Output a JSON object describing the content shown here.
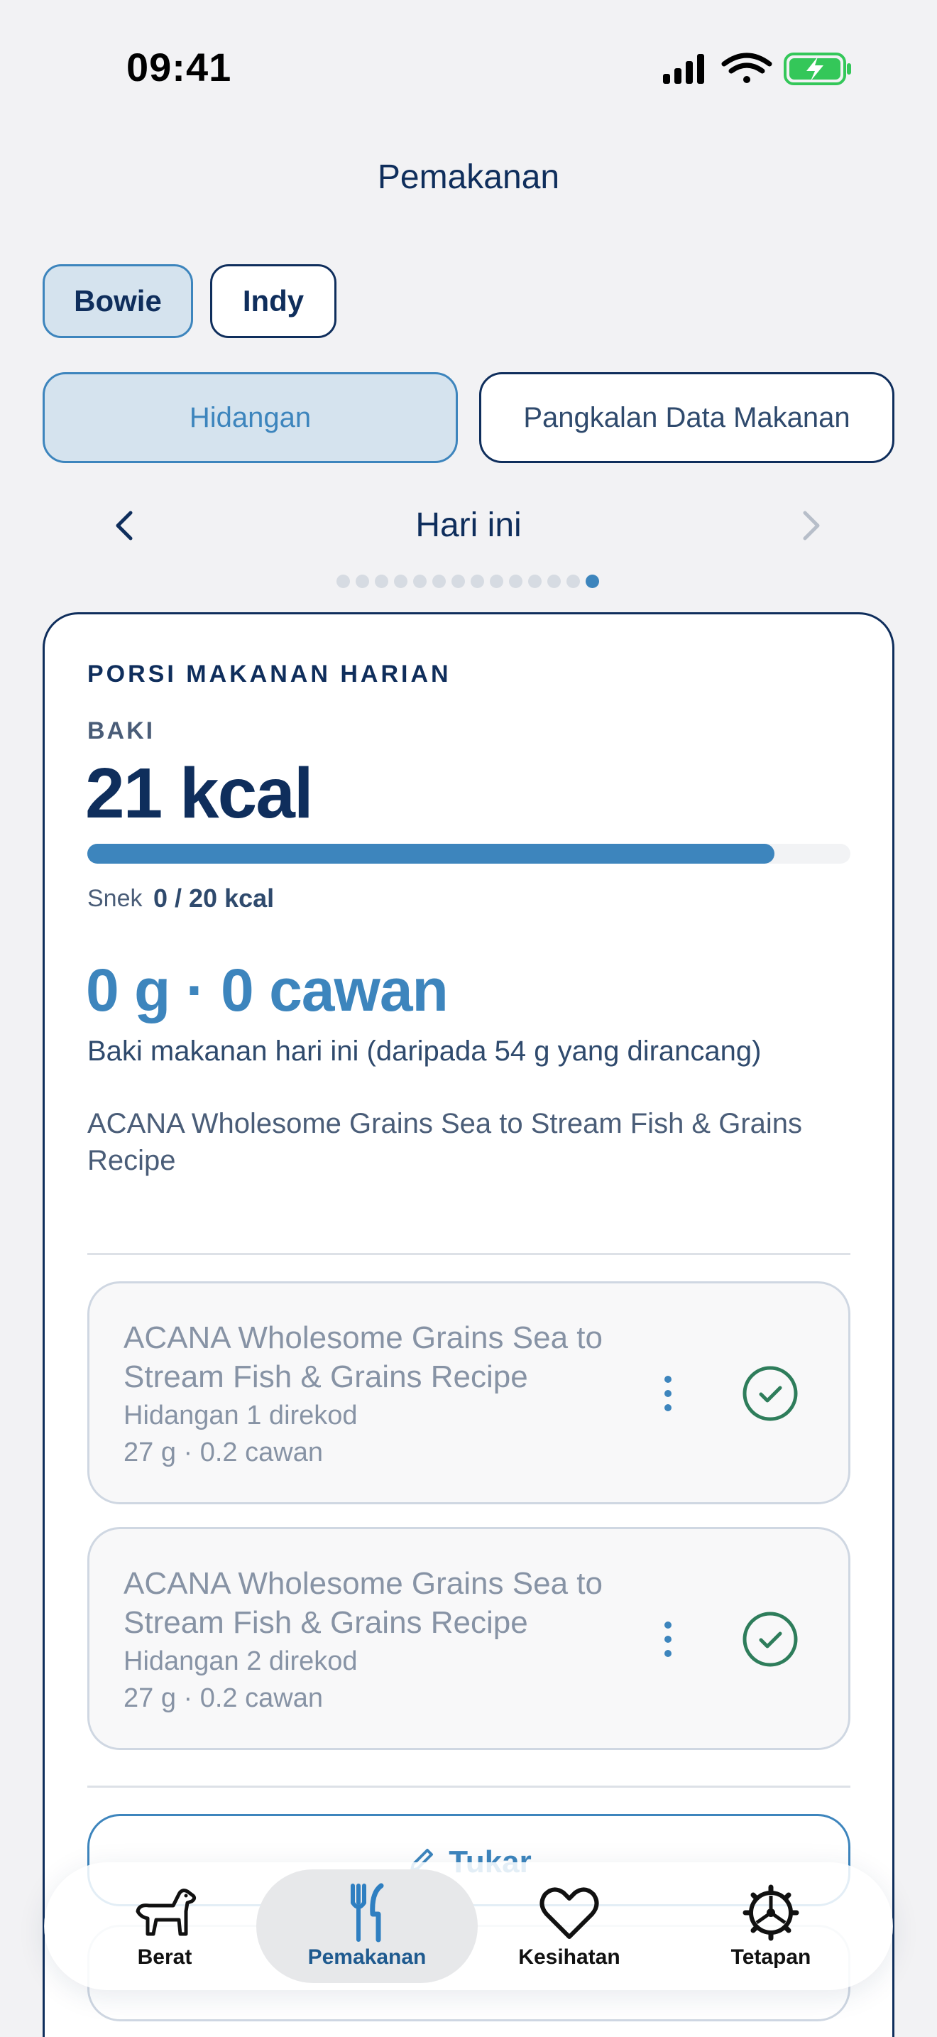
{
  "status": {
    "time": "09:41"
  },
  "page": {
    "title": "Pemakanan"
  },
  "pets": [
    {
      "label": "Bowie",
      "active": true
    },
    {
      "label": "Indy",
      "active": false
    }
  ],
  "modes": [
    {
      "label": "Hidangan",
      "active": true
    },
    {
      "label": "Pangkalan Data Makanan",
      "active": false
    }
  ],
  "date_nav": {
    "label": "Hari ini",
    "page_count": 14,
    "active_page": 14
  },
  "daily": {
    "section_title": "PORSI MAKANAN HARIAN",
    "remaining_label": "BAKI",
    "remaining_kcal": "21 kcal",
    "progress_fraction": 0.9,
    "snack_label": "Snek",
    "snack_value": "0 / 20 kcal",
    "grams_cups": "0 g · 0 cawan",
    "remaining_desc": "Baki makanan hari ini (daripada 54 g yang dirancang)",
    "food_name": "ACANA Wholesome Grains Sea to Stream Fish & Grains Recipe"
  },
  "meals": [
    {
      "title": "ACANA Wholesome Grains Sea to Stream Fish & Grains Recipe",
      "status": "Hidangan 1 direkod",
      "amount": "27 g · 0.2 cawan"
    },
    {
      "title": "ACANA Wholesome Grains Sea to Stream Fish & Grains Recipe",
      "status": "Hidangan 2 direkod",
      "amount": "27 g · 0.2 cawan"
    }
  ],
  "actions": {
    "swap_label": "Tukar"
  },
  "tabbar": [
    {
      "label": "Berat",
      "icon": "dog-icon",
      "active": false
    },
    {
      "label": "Pemakanan",
      "icon": "fork-knife-icon",
      "active": true
    },
    {
      "label": "Kesihatan",
      "icon": "heart-icon",
      "active": false
    },
    {
      "label": "Tetapan",
      "icon": "gear-icon",
      "active": false
    }
  ],
  "colors": {
    "navy": "#0f2e5c",
    "accent": "#3d85bd",
    "accent_light": "#d5e3ee",
    "success": "#2e7d5b",
    "background": "#f2f2f4"
  }
}
